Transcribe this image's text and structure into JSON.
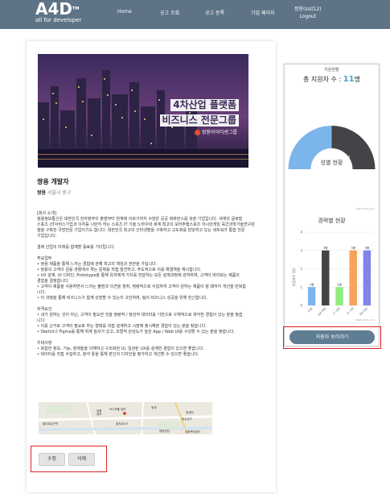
{
  "header": {
    "logo_main": "A4D",
    "logo_tm": "TM",
    "logo_sub": "all for developer",
    "nav": [
      "Home",
      "공고 조회",
      "공고 등록",
      "기업 페이지"
    ],
    "user_name": "쌍용(sist12)",
    "logout": "Logout"
  },
  "hero": {
    "line1": "4차산업 플랫폼",
    "line2": "비즈니스 전문그룹",
    "brand": "쌍용아이티센그룹"
  },
  "job": {
    "title": "쌍용 개발자",
    "company": "쌍용",
    "location": "서울시 중구"
  },
  "description": {
    "intro_heading": "[회사 소개]",
    "intro_lines": [
      "쌍용정보통신은 대한민국 전자정부의 출범부터 현재에 이르기까지 수많은 공공 레퍼런스를 갖춘 기업입니다. 세계의 글로벌",
      "스포츠 (IT서비스기업과 이처를 나란히 하는 스포츠 IT 기술 노하우와 세계 최고의 모터주행스포츠 아시안게임 육군과학기술연구원",
      "참을 구축한 국방전문 기업이기도 합니다. 대한민국 최고의 인터넷맨을 구축하고 고도화를 담당하고 있는 네트워크 통합 전문",
      "기업입니다."
    ],
    "intro_closing": "결제 산업의 미래를 함께할 동료를 기다립니다.",
    "duties_heading": "주요업무",
    "duties": [
      "• 쌍용 제품을 통해 느끼는 경험에 관해 최고의 책임과 권한을 가집니다.",
      "• 쌍용의 고객이 금융 생활에서 겪는 문제를 직접 발견하고, 주도적으로 이를 해결책을 제시합니다.",
      "• UX 설계, UI 디자인, Prototype을 통해 유저에게 가치를 전달하는 모든 설계과정에 관여하며, 고객이 바라보는 제품의",
      "경험을 결정합니다.",
      "• 고객이 제품을 사용하면서 느끼는 불편과 의견을 청취, 정량적으로 수집하여 고객이 원하는 제품이 될 때까지 개선을 반복합",
      "니다.",
      "• 이 과정을 통해 비즈니스가 함께 성장할 수 있는지 고민하며, 팀의 비즈니스 성공을 위해 헌신합니다."
    ],
    "qual_heading": "자격요건",
    "quals": [
      "• 내가 원하는 것이 아닌, 고객이 필요한 것을 정량적 / 정성적 데이터를 기반으로 구체적으로 파악한 경험이 있는 분을 찾습",
      "니다.",
      "• 이를 근거로 고객이 필요로 하는 형태를 직접 설계하고 시장에 출시해본 경험이 있는 분을 찾습니다.",
      "• Sketch나 Figma를 통해 위계 질서가 있고, 조형적 완성도가 높은 App / Web UI를 구성할 수 있는 분을 찾습니다."
    ],
    "pref_heading": "우대사항",
    "prefs": [
      "• 복잡한 정보, 기능, 정책들을 이해하고 구조화된 UI, 일관된 UX를 설계한 경험이 있으면 좋습니다.",
      "• 데이터를 직접 수집하고, 분석 툴을 통해 본인의 디자인을 평가하고 개선할 수 있으면 좋습니다."
    ]
  },
  "map": {
    "labels": [
      "쌍용",
      "정보",
      "코스모폴 정보",
      "을지로3가",
      "을지로입구역",
      "청계",
      "청계천",
      "동승상가",
      "명동성당",
      "사회복지공단"
    ]
  },
  "buttons": {
    "edit": "수정",
    "delete": "삭제"
  },
  "stats": {
    "label": "지원현황",
    "total_prefix": "총 지원자 수 : ",
    "total_count": "11",
    "total_suffix": "명"
  },
  "gender_chart": {
    "title": "성별 현황",
    "credit": "Highcharts.com",
    "label_male": "남자",
    "label_female": "여자",
    "colors": {
      "male": "#7cb5ec",
      "female": "#434348"
    }
  },
  "chart_data": {
    "type": "bar",
    "title": "경력별 현황",
    "ylabel": "지원자수 (명)",
    "categories": [
      "신입",
      "1년 미만",
      "1~3년",
      "4~7년",
      "7년 이상"
    ],
    "values": [
      1,
      3,
      1,
      3,
      3
    ],
    "value_labels": [
      "1명",
      "3명",
      "1명",
      "3명",
      "3명"
    ],
    "colors": [
      "#7cb5ec",
      "#434348",
      "#90ed7d",
      "#f7a35c",
      "#8085e9"
    ],
    "ylim": [
      0,
      4
    ],
    "yticks": [
      0,
      1,
      2,
      3,
      4
    ],
    "credit": "Highcharts.com"
  },
  "apply_list_label": "지원자 보러가기"
}
